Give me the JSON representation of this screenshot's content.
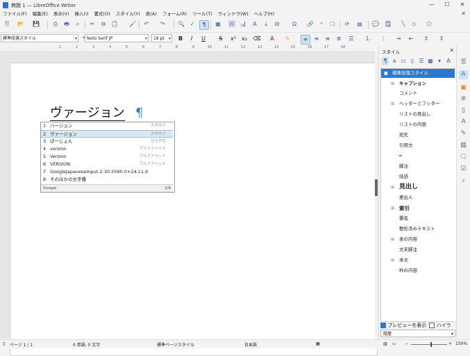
{
  "window": {
    "title": "無題 1 — LibreOffice Writer"
  },
  "menu": [
    "ファイル(F)",
    "編集(E)",
    "表示(V)",
    "挿入(I)",
    "書式(O)",
    "スタイル(Y)",
    "表(A)",
    "フォーム(R)",
    "ツール(T)",
    "ウィンドウ(W)",
    "ヘルプ(H)"
  ],
  "formatting": {
    "paragraph_style": "標準段落スタイル",
    "font_name": "Noto Serif JP",
    "font_size": "18 pt"
  },
  "document": {
    "heading": "ヴァージョン",
    "pilcrow": "¶"
  },
  "ruler": [
    "1",
    "2",
    "3",
    "4",
    "5",
    "6",
    "7",
    "8",
    "9",
    "10",
    "11",
    "12",
    "13",
    "14",
    "15",
    "16",
    "17",
    "18"
  ],
  "ime": {
    "candidates": [
      {
        "n": "1",
        "text": "バージョン",
        "kind": "カタカナ"
      },
      {
        "n": "2",
        "text": "ヴァージョン",
        "kind": "カタカナ"
      },
      {
        "n": "3",
        "text": "ばーじょん",
        "kind": "ひらがな"
      },
      {
        "n": "4",
        "text": "version",
        "kind": "アルファベット"
      },
      {
        "n": "5",
        "text": "Version",
        "kind": "アルファベット"
      },
      {
        "n": "6",
        "text": "VERSION",
        "kind": "アルファベット"
      },
      {
        "n": "7",
        "text": "GoogleJapaneseInput-2.30.5590.0+24.11.9",
        "kind": ""
      },
      {
        "n": "8",
        "text": "そのほかの文字種",
        "kind": ""
      }
    ],
    "selected_index": 1,
    "brand": "Google",
    "count": "2/8"
  },
  "sidebar": {
    "title": "スタイル",
    "styles": [
      {
        "label": "標準段落スタイル",
        "expandable": false,
        "selected": true,
        "level": 0
      },
      {
        "label": "キャプション",
        "expandable": true,
        "level": 1
      },
      {
        "label": "コメント",
        "expandable": false,
        "level": 1
      },
      {
        "label": "ヘッダーとフッター",
        "expandable": true,
        "level": 1
      },
      {
        "label": "リストの見出し",
        "expandable": false,
        "level": 1
      },
      {
        "label": "リストの内容",
        "expandable": false,
        "level": 1
      },
      {
        "label": "宛先",
        "expandable": false,
        "level": 1
      },
      {
        "label": "引用文",
        "expandable": false,
        "level": 1
      },
      {
        "label": "━",
        "expandable": false,
        "level": 1
      },
      {
        "label": "脚注",
        "expandable": false,
        "level": 1
      },
      {
        "label": "結語",
        "expandable": false,
        "level": 1
      },
      {
        "label": "見出し",
        "expandable": true,
        "level": 1
      },
      {
        "label": "差出人",
        "expandable": false,
        "level": 1
      },
      {
        "label": "索引",
        "expandable": true,
        "level": 1
      },
      {
        "label": "署名",
        "expandable": false,
        "level": 1
      },
      {
        "label": "整形済みテキスト",
        "expandable": false,
        "level": 1
      },
      {
        "label": "表の内容",
        "expandable": true,
        "level": 1
      },
      {
        "label": "文末脚注",
        "expandable": false,
        "level": 1
      },
      {
        "label": "本文",
        "expandable": true,
        "level": 1
      },
      {
        "label": "枠の内容",
        "expandable": false,
        "level": 1
      }
    ],
    "preview_label": "プレビューを表示",
    "preview_checked": true,
    "highlight_label": "ハイライト",
    "highlight_checked": false,
    "filter": "階層"
  },
  "status": {
    "page": "ページ 1 / 1",
    "words": "0 単語, 0 文字",
    "page_style": "標準ページスタイル",
    "language": "日本語",
    "zoom": "150%"
  },
  "colors": {
    "accent": "#2a79d0"
  }
}
